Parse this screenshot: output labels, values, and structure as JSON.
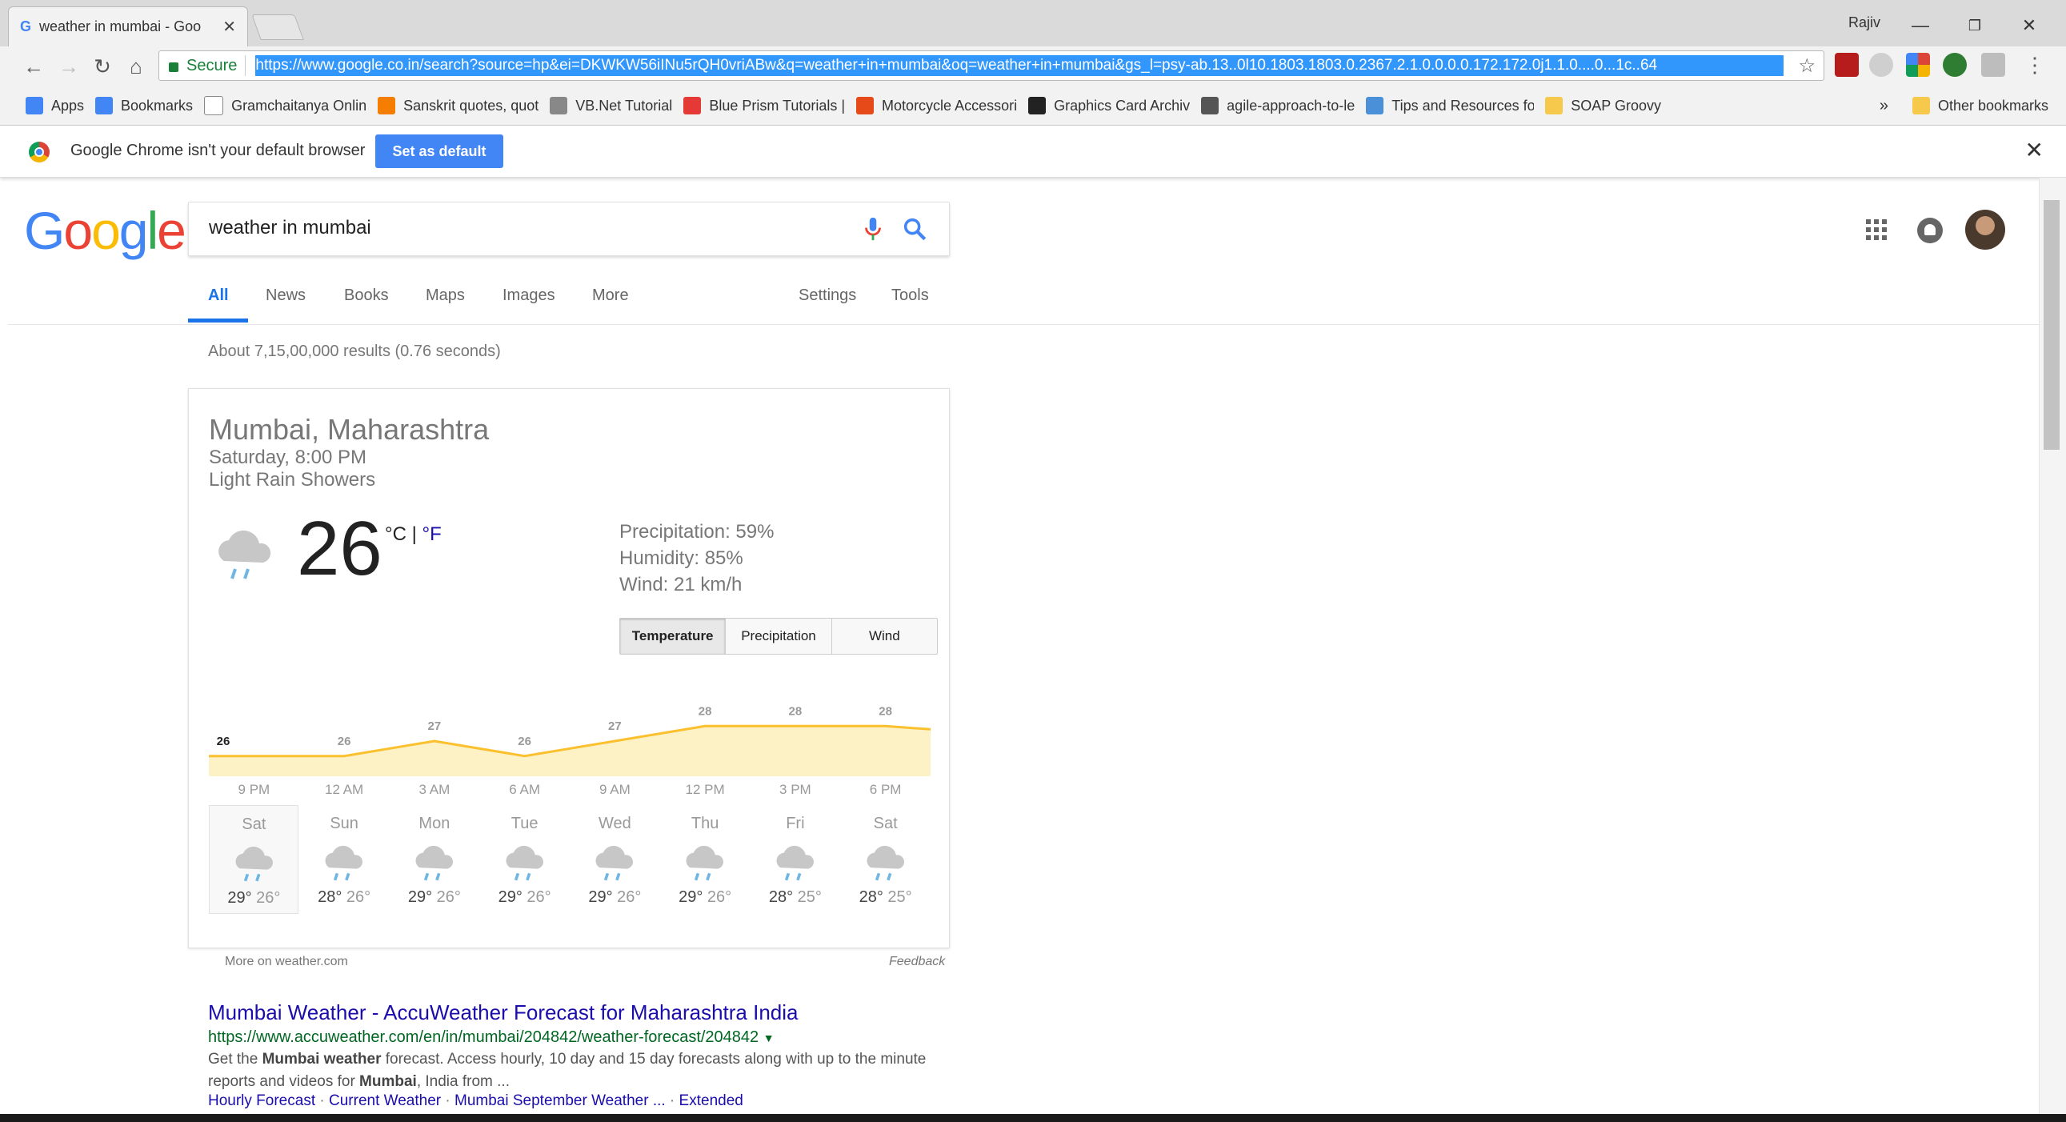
{
  "browser": {
    "tab_title": "weather in mumbai - Goo",
    "profile_name": "Rajiv",
    "url": "https://www.google.co.in/search?source=hp&ei=DKWKW56iINu5rQH0vriABw&q=weather+in+mumbai&oq=weather+in+mumbai&gs_l=psy-ab.13..0l10.1803.1803.0.2367.2.1.0.0.0.0.172.172.0j1.1.0....0...1c..64",
    "secure_label": "Secure",
    "bookmarks": [
      {
        "label": "Apps",
        "icon": "apps-grid-icon",
        "color": "#4285f4"
      },
      {
        "label": "Bookmarks",
        "icon": "star-icon",
        "color": "#4285f4"
      },
      {
        "label": "Gramchaitanya Onlin",
        "icon": "page-icon",
        "color": "#ffffff"
      },
      {
        "label": "Sanskrit quotes, quot",
        "icon": "blogger-icon",
        "color": "#f57d00"
      },
      {
        "label": "VB.Net Tutorial",
        "icon": "diamond-icon",
        "color": "#888888"
      },
      {
        "label": "Blue Prism Tutorials |",
        "icon": "circle-icon",
        "color": "#e53935"
      },
      {
        "label": "Motorcycle Accessori",
        "icon": "magento-icon",
        "color": "#e64a19"
      },
      {
        "label": "Graphics Card Archiv",
        "icon": "gamepad-icon",
        "color": "#222222"
      },
      {
        "label": "agile-approach-to-le",
        "icon": "swirl-icon",
        "color": "#555555"
      },
      {
        "label": "Tips and Resources fo",
        "icon": "picture-icon",
        "color": "#4a90d9"
      },
      {
        "label": "SOAP Groovy",
        "icon": "folder-icon",
        "color": "#f6c84c"
      }
    ],
    "bookmarks_overflow": "»",
    "other_bookmarks": "Other bookmarks",
    "infobar_message": "Google Chrome isn't your default browser",
    "infobar_button": "Set as default"
  },
  "google": {
    "logo": "Google",
    "logo_colors": [
      "#4285f4",
      "#ea4335",
      "#fbbc05",
      "#4285f4",
      "#34a853",
      "#ea4335"
    ],
    "query": "weather in mumbai",
    "tabs": [
      "All",
      "News",
      "Books",
      "Maps",
      "Images",
      "More"
    ],
    "tools": [
      "Settings",
      "Tools"
    ],
    "result_stats": "About 7,15,00,000 results (0.76 seconds)"
  },
  "weather": {
    "location": "Mumbai, Maharashtra",
    "time": "Saturday, 8:00 PM",
    "condition": "Light Rain Showers",
    "temperature": "26",
    "unit_c": "°C",
    "unit_sep": " | ",
    "unit_f": "°F",
    "precipitation": "Precipitation: 59%",
    "humidity": "Humidity: 85%",
    "wind": "Wind: 21 km/h",
    "modes": [
      "Temperature",
      "Precipitation",
      "Wind"
    ],
    "active_mode": "Temperature",
    "more_link": "More on weather.com",
    "feedback": "Feedback",
    "forecast": [
      {
        "day": "Sat",
        "high": "29°",
        "low": "26°"
      },
      {
        "day": "Sun",
        "high": "28°",
        "low": "26°"
      },
      {
        "day": "Mon",
        "high": "29°",
        "low": "26°"
      },
      {
        "day": "Tue",
        "high": "29°",
        "low": "26°"
      },
      {
        "day": "Wed",
        "high": "29°",
        "low": "26°"
      },
      {
        "day": "Thu",
        "high": "29°",
        "low": "26°"
      },
      {
        "day": "Fri",
        "high": "28°",
        "low": "25°"
      },
      {
        "day": "Sat",
        "high": "28°",
        "low": "25°"
      }
    ]
  },
  "chart_data": {
    "type": "area",
    "x": [
      "9 PM",
      "12 AM",
      "3 AM",
      "6 AM",
      "9 AM",
      "12 PM",
      "3 PM",
      "6 PM"
    ],
    "values": [
      26,
      26,
      27,
      26,
      27,
      28,
      28,
      28
    ],
    "line_color": "#fbc02d",
    "fill_color": "#fdf1c6"
  },
  "result": {
    "title": "Mumbai Weather - AccuWeather Forecast for Maharashtra India",
    "url": "https://www.accuweather.com/en/in/mumbai/204842/weather-forecast/204842",
    "desc_1": "Get the ",
    "desc_b1": "Mumbai weather",
    "desc_2": " forecast. Access hourly, 10 day and 15 day forecasts along with up to the minute reports and videos for ",
    "desc_b2": "Mumbai",
    "desc_3": ", India from ...",
    "links": [
      "Hourly Forecast",
      "Current Weather",
      "Mumbai September Weather ...",
      "Extended"
    ]
  }
}
